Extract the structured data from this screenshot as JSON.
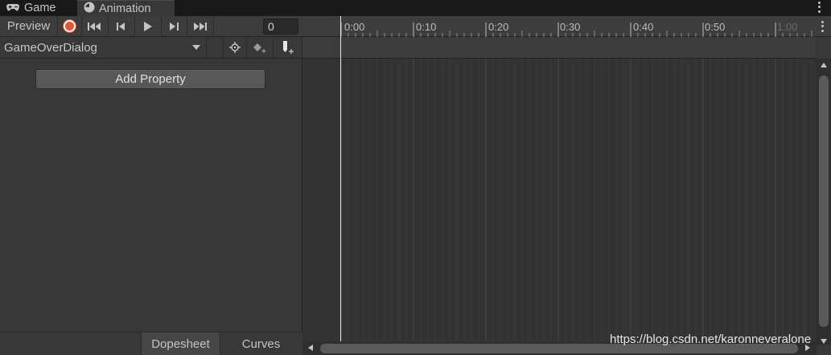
{
  "tabs": {
    "game_label": "Game",
    "animation_label": "Animation"
  },
  "toolbar": {
    "preview_label": "Preview",
    "frame_value": "0"
  },
  "clip": {
    "selected": "GameOverDialog"
  },
  "add_property_label": "Add Property",
  "bottom_tabs": {
    "dopesheet_label": "Dopesheet",
    "curves_label": "Curves"
  },
  "timeline": {
    "labels": [
      "0:00",
      "0:10",
      "0:20",
      "0:30",
      "0:40",
      "0:50",
      "1:00"
    ]
  },
  "watermark": "https://blog.csdn.net/karonneveralone",
  "colors": {
    "record": "#e2583e",
    "panel": "#383838",
    "tabbar": "#191919"
  }
}
